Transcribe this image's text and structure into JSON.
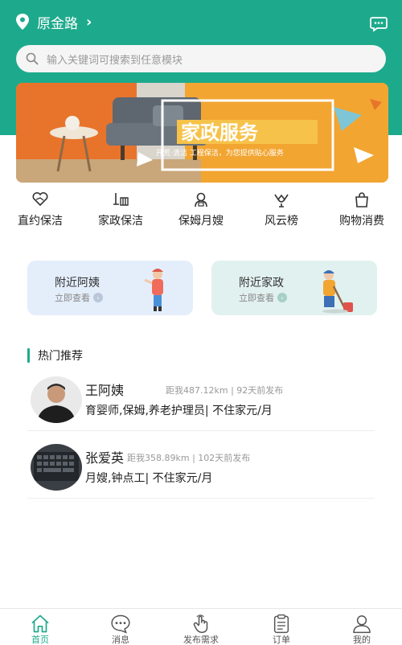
{
  "header": {
    "city": "原金路",
    "search_placeholder": "输入关键词可搜索到任意模块"
  },
  "banner": {
    "title": "家政服务",
    "subtitle": "开荒·清洁 工程保洁，为您提供贴心服务"
  },
  "categories": [
    {
      "label": "直约保洁",
      "icon": "handshake-heart-icon"
    },
    {
      "label": "家政保洁",
      "icon": "mop-icon"
    },
    {
      "label": "保姆月嫂",
      "icon": "nanny-icon"
    },
    {
      "label": "风云榜",
      "icon": "trophy-icon"
    },
    {
      "label": "购物消费",
      "icon": "shopping-bag-icon"
    }
  ],
  "nearby": [
    {
      "title": "附近阿姨",
      "sub": "立即查看"
    },
    {
      "title": "附近家政",
      "sub": "立即查看"
    }
  ],
  "hot": {
    "title": "热门推荐",
    "items": [
      {
        "name": "王阿姨",
        "meta": "距我487.12km | 92天前发布",
        "desc": "育婴师,保姆,养老护理员| 不住家元/月"
      },
      {
        "name": "张爱英",
        "meta": "距我358.89km | 102天前发布",
        "desc": "月嫂,钟点工| 不住家元/月"
      }
    ]
  },
  "tabbar": [
    {
      "label": "首页",
      "icon": "home-icon",
      "active": true
    },
    {
      "label": "消息",
      "icon": "message-icon",
      "active": false
    },
    {
      "label": "发布需求",
      "icon": "tap-hand-icon",
      "active": false
    },
    {
      "label": "订单",
      "icon": "order-clipboard-icon",
      "active": false
    },
    {
      "label": "我的",
      "icon": "user-icon",
      "active": false
    }
  ],
  "colors": {
    "brand": "#1daa8c",
    "banner": "#f2a531"
  }
}
